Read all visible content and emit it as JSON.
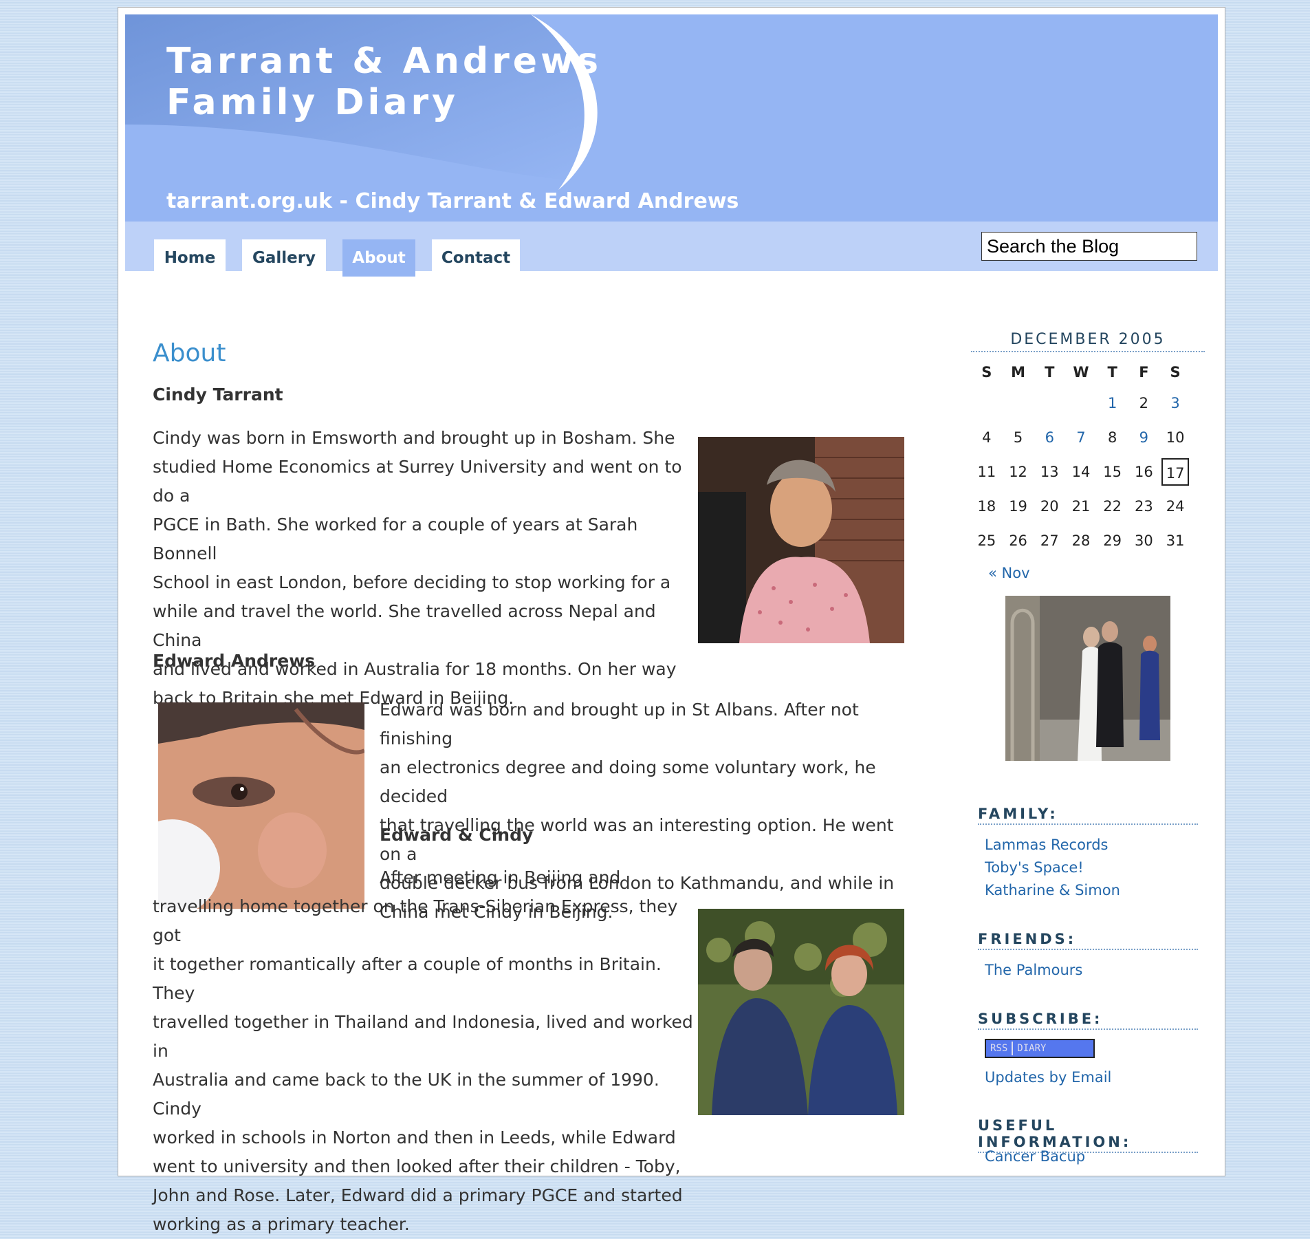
{
  "header": {
    "title_line1": "Tarrant & Andrews",
    "title_line2": "Family Diary",
    "tagline": "tarrant.org.uk - Cindy Tarrant & Edward Andrews"
  },
  "nav": {
    "tabs": [
      {
        "label": "Home",
        "active": false
      },
      {
        "label": "Gallery",
        "active": false
      },
      {
        "label": "About",
        "active": true
      },
      {
        "label": "Contact",
        "active": false
      }
    ],
    "search_value": "Search the Blog"
  },
  "main": {
    "title": "About",
    "cindy_heading": "Cindy Tarrant",
    "cindy_lines": [
      "Cindy was born in Emsworth and brought up in Bosham. She",
      "studied Home Economics at Surrey University and went on to do a",
      "PGCE in Bath. She worked for a couple of years at Sarah Bonnell",
      "School in east London, before deciding to stop working for a",
      "while and travel the world. She travelled across Nepal and China",
      "and lived and worked in Australia for 18 months. On her way",
      "back to Britain she met Edward in Beijing."
    ],
    "edward_heading": "Edward Andrews",
    "edward_lines": [
      "Edward was born and brought up in St Albans. After not finishing",
      "an electronics degree and doing some voluntary work, he decided",
      "that travelling the world was an interesting option. He went on a",
      "double decker bus from London to Kathmandu, and while in",
      "China met Cindy in Beijing."
    ],
    "both_heading": "Edward & Cindy",
    "both_lines": [
      "After meeting in Beijing and",
      "travelling home together on the Trans-Siberian Express, they got",
      "it together romantically after a couple of months in Britain. They",
      "travelled together in Thailand and Indonesia, lived and worked in",
      "Australia and came back to the UK in the summer of 1990. Cindy",
      "worked in schools in Norton and then in Leeds, while Edward",
      "went to university and then looked after their children - Toby,",
      "John and Rose. Later, Edward did a primary PGCE and started",
      "working as a primary teacher."
    ]
  },
  "sidebar": {
    "calendar": {
      "title": "DECEMBER 2005",
      "weekdays": [
        "S",
        "M",
        "T",
        "W",
        "T",
        "F",
        "S"
      ],
      "weeks": [
        [
          "",
          "",
          "",
          "",
          "1",
          "2",
          "3"
        ],
        [
          "4",
          "5",
          "6",
          "7",
          "8",
          "9",
          "10"
        ],
        [
          "11",
          "12",
          "13",
          "14",
          "15",
          "16",
          "17"
        ],
        [
          "18",
          "19",
          "20",
          "21",
          "22",
          "23",
          "24"
        ],
        [
          "25",
          "26",
          "27",
          "28",
          "29",
          "30",
          "31"
        ]
      ],
      "linked_days": [
        "1",
        "3",
        "6",
        "7",
        "9"
      ],
      "today": "17",
      "prev_link": "« Nov"
    },
    "family_heading": "FAMILY:",
    "family_links": [
      "Lammas Records",
      "Toby's Space!",
      "Katharine & Simon"
    ],
    "friends_heading": "FRIENDS:",
    "friends_links": [
      "The Palmours"
    ],
    "subscribe_heading": "SUBSCRIBE:",
    "rss_badge": {
      "left": "RSS",
      "right": "DIARY"
    },
    "updates_link": "Updates by Email",
    "useful_heading": "USEFUL INFORMATION:",
    "useful_links": [
      "Cancer Bacup"
    ]
  },
  "colors": {
    "header_bg": "#95b5f3",
    "nav_bg": "#bdd1f8",
    "title_blue": "#3b8fcd",
    "link_blue": "#2266aa"
  }
}
